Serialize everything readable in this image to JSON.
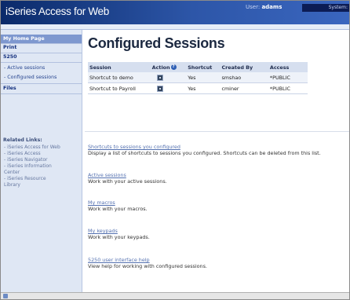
{
  "header": {
    "brand": "iSeries Access for Web",
    "user_label": "User:",
    "user_name": "adams",
    "system_label": "System:"
  },
  "sidebar": {
    "items": [
      {
        "label": "My Home Page"
      },
      {
        "label": "Print"
      },
      {
        "label": "5250"
      },
      {
        "label": "- Active sessions"
      },
      {
        "label": "- Configured sessions"
      },
      {
        "label": "Files"
      }
    ],
    "related_title": "Related Links:",
    "related_links": [
      "- iSeries Access for Web",
      "- iSeries Access",
      "- iSeries Navigator",
      "- iSeries Information",
      "  Center",
      "- iSeries Resource",
      "  Library"
    ]
  },
  "main": {
    "title": "Configured Sessions",
    "table": {
      "headers": [
        "Session",
        "Action",
        "Shortcut",
        "Created By",
        "Access"
      ],
      "rows": [
        {
          "session": "Shortcut to demo",
          "shortcut": "Yes",
          "created_by": "smshao",
          "access": "*PUBLIC"
        },
        {
          "session": "Shortcut to Payroll",
          "shortcut": "Yes",
          "created_by": "cminer",
          "access": "*PUBLIC"
        }
      ]
    },
    "links": [
      {
        "title": "Shortcuts to sessions you configured",
        "desc": "Display a list of shortcuts to sessions you configured. Shortcuts can be deleted from this list."
      },
      {
        "title": "Active sessions",
        "desc": "Work with your active sessions."
      },
      {
        "title": "My macros",
        "desc": "Work with your macros."
      },
      {
        "title": "My keypads",
        "desc": "Work with your keypads."
      },
      {
        "title": "5250 user interface help",
        "desc": "View help for working with configured sessions."
      }
    ]
  },
  "colors": {
    "header_dark": "#0a2a6a",
    "header_light": "#3a66bf",
    "sidebar_bg": "#dfe7f4",
    "nav_highlight": "#7e98cf",
    "link": "#5471b0"
  }
}
